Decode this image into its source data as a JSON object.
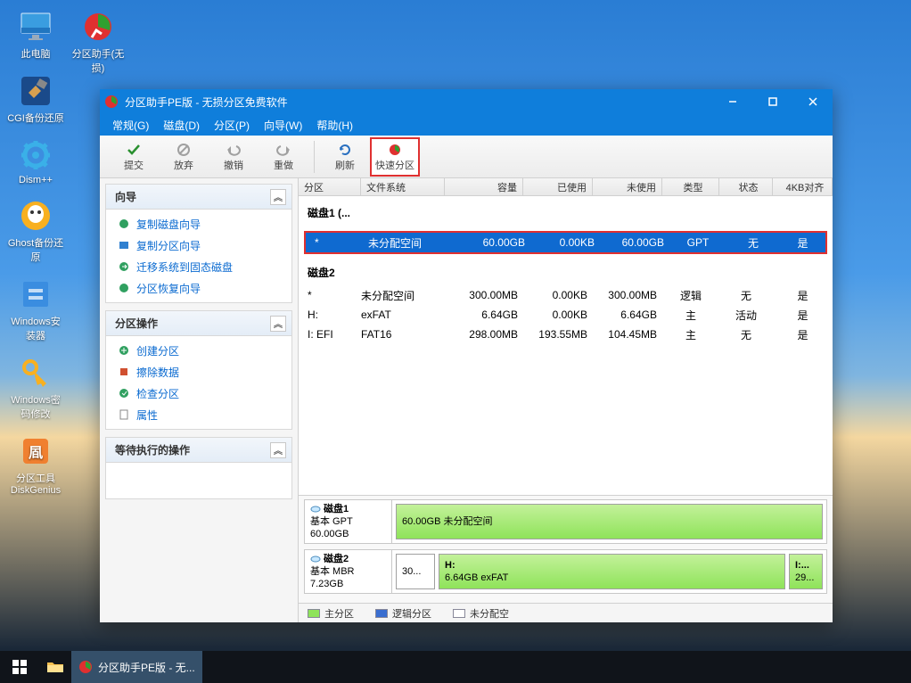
{
  "desktop": {
    "icons": [
      {
        "label": "此电脑",
        "name": "this-pc"
      },
      {
        "label": "分区助手(无\n损)",
        "name": "paragon-assistant"
      },
      {
        "label": "CGI备份还原",
        "name": "cgi-backup"
      },
      {
        "label": "Dism++",
        "name": "dism"
      },
      {
        "label": "Ghost备份还原",
        "name": "ghost"
      },
      {
        "label": "Windows安装器",
        "name": "win-installer"
      },
      {
        "label": "Windows密码修改",
        "name": "win-password"
      },
      {
        "label": "分区工具DiskGenius",
        "name": "diskgenius"
      }
    ]
  },
  "window": {
    "title": "分区助手PE版 - 无损分区免费软件",
    "menu": [
      "常规(G)",
      "磁盘(D)",
      "分区(P)",
      "向导(W)",
      "帮助(H)"
    ],
    "toolbar": {
      "commit": "提交",
      "discard": "放弃",
      "undo": "撤销",
      "redo": "重做",
      "refresh": "刷新",
      "quick": "快速分区"
    },
    "sidebar": {
      "wizard": {
        "title": "向导",
        "items": [
          "复制磁盘向导",
          "复制分区向导",
          "迁移系统到固态磁盘",
          "分区恢复向导"
        ]
      },
      "ops": {
        "title": "分区操作",
        "items": [
          "创建分区",
          "擦除数据",
          "检查分区",
          "属性"
        ]
      },
      "pending": {
        "title": "等待执行的操作"
      }
    },
    "grid": {
      "headers": {
        "partition": "分区",
        "filesystem": "文件系统",
        "capacity": "容量",
        "used": "已使用",
        "free": "未使用",
        "type": "类型",
        "status": "状态",
        "align": "4KB对齐"
      },
      "disk1_label": "磁盘1 (...",
      "disk1_rows": [
        {
          "part": "*",
          "fs": "未分配空间",
          "cap": "60.00GB",
          "used": "0.00KB",
          "free": "60.00GB",
          "type": "GPT",
          "stat": "无",
          "align": "是"
        }
      ],
      "disk2_label": "磁盘2",
      "disk2_rows": [
        {
          "part": "*",
          "fs": "未分配空间",
          "cap": "300.00MB",
          "used": "0.00KB",
          "free": "300.00MB",
          "type": "逻辑",
          "stat": "无",
          "align": "是"
        },
        {
          "part": "H:",
          "fs": "exFAT",
          "cap": "6.64GB",
          "used": "0.00KB",
          "free": "6.64GB",
          "type": "主",
          "stat": "活动",
          "align": "是"
        },
        {
          "part": "I: EFI",
          "fs": "FAT16",
          "cap": "298.00MB",
          "used": "193.55MB",
          "free": "104.45MB",
          "type": "主",
          "stat": "无",
          "align": "是"
        }
      ]
    },
    "diskmap": {
      "d1": {
        "title": "磁盘1",
        "sub": "基本 GPT",
        "size": "60.00GB",
        "block": "60.00GB 未分配空间"
      },
      "d2": {
        "title": "磁盘2",
        "sub": "基本 MBR",
        "size": "7.23GB",
        "b1": "30...",
        "b2t": "H:",
        "b2s": "6.64GB exFAT",
        "b3t": "I:...",
        "b3s": "29..."
      }
    },
    "status": {
      "primary": "主分区",
      "logical": "逻辑分区",
      "unalloc": "未分配空"
    }
  },
  "taskbar": {
    "app": "分区助手PE版 - 无..."
  }
}
